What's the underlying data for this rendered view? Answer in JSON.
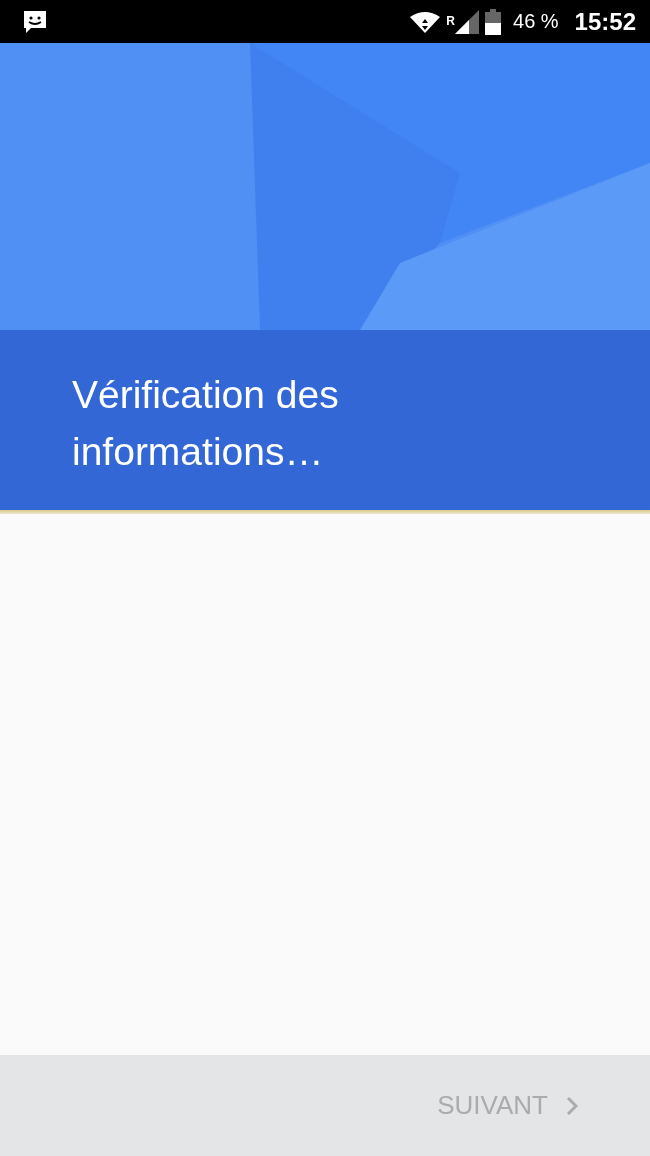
{
  "status_bar": {
    "roaming": "R",
    "battery": "46 %",
    "time": "15:52"
  },
  "header": {
    "title": "Vérification des informations…"
  },
  "footer": {
    "next_button": {
      "label": "SUIVANT",
      "disabled": true
    }
  }
}
